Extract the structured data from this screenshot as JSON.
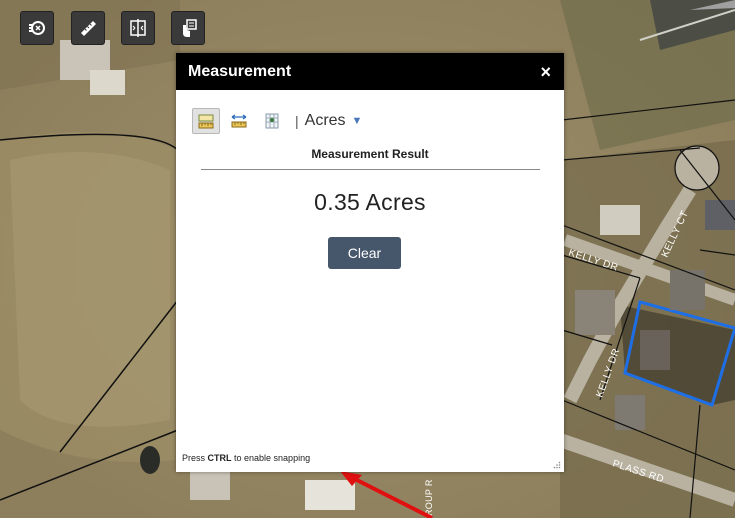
{
  "toolbar": {
    "buttons": [
      {
        "icon": "layers-search-icon"
      },
      {
        "icon": "ruler-icon"
      },
      {
        "icon": "swipe-compare-icon"
      },
      {
        "icon": "identify-pointer-icon"
      }
    ]
  },
  "map": {
    "road_labels": [
      "KELLY CT",
      "KELLY DR",
      "KELLY DR",
      "PLASS RD",
      "ROUP R"
    ],
    "highlight_color": "#1e6fe6"
  },
  "panel": {
    "title": "Measurement",
    "close_glyph": "×",
    "tools": [
      {
        "icon": "area-measure-icon",
        "active": true
      },
      {
        "icon": "distance-measure-icon",
        "active": false
      },
      {
        "icon": "location-measure-icon",
        "active": false
      }
    ],
    "separator": "|",
    "unit": "Acres",
    "result_label": "Measurement Result",
    "result_value": "0.35 Acres",
    "clear_label": "Clear",
    "hint_prefix": "Press ",
    "hint_key": "CTRL",
    "hint_suffix": " to enable snapping"
  },
  "colors": {
    "header_bg": "#000000",
    "clear_button_bg": "#46576b",
    "arrow": "#e01010"
  }
}
